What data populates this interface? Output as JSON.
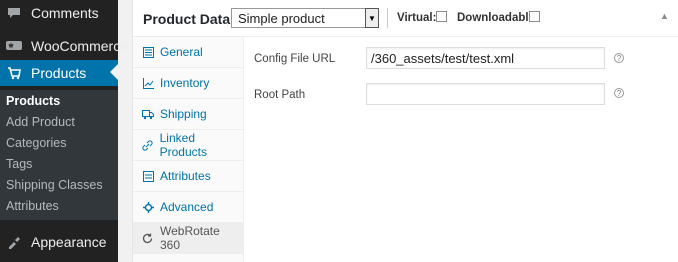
{
  "sidebar": {
    "items": [
      {
        "label": "Comments",
        "icon": "comment-icon"
      },
      {
        "label": "WooCommerce",
        "icon": "woocommerce-icon"
      },
      {
        "label": "Products",
        "icon": "products-icon"
      },
      {
        "label": "Appearance",
        "icon": "appearance-icon"
      }
    ],
    "submenu": [
      "Products",
      "Add Product",
      "Categories",
      "Tags",
      "Shipping Classes",
      "Attributes"
    ]
  },
  "product_data": {
    "title": "Product Data —",
    "type_select": "Simple product",
    "virtual_label": "Virtual:",
    "downloadable_label": "Downloadable:"
  },
  "tabs": [
    {
      "label": "General",
      "icon": "general-icon"
    },
    {
      "label": "Inventory",
      "icon": "inventory-icon"
    },
    {
      "label": "Shipping",
      "icon": "shipping-icon"
    },
    {
      "label": "Linked Products",
      "icon": "link-icon"
    },
    {
      "label": "Attributes",
      "icon": "attributes-icon"
    },
    {
      "label": "Advanced",
      "icon": "advanced-icon"
    },
    {
      "label": "WebRotate 360",
      "icon": "rotate-icon"
    }
  ],
  "fields": {
    "config_label": "Config File URL",
    "config_value": "/360_assets/test/test.xml",
    "root_label": "Root Path",
    "root_value": ""
  },
  "colors": {
    "accent": "#0073aa",
    "sidebar": "#222222"
  }
}
